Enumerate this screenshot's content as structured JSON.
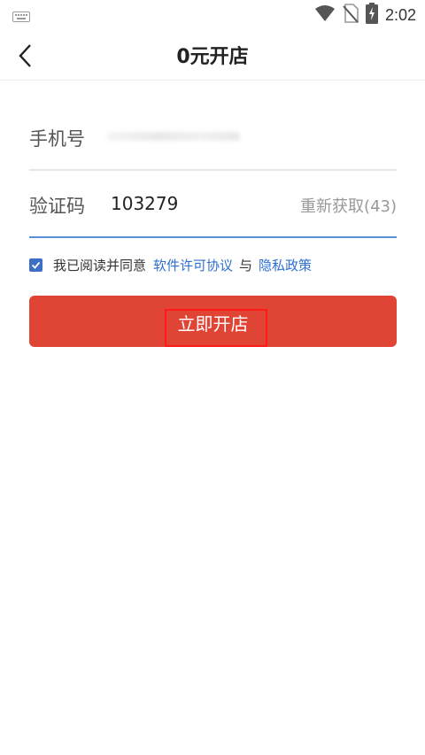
{
  "status_bar": {
    "time": "2:02",
    "icons": [
      "keyboard-icon",
      "wifi-icon",
      "no-sim-icon",
      "battery-charging-icon"
    ]
  },
  "header": {
    "title": "0元开店",
    "back_icon": "chevron-left-icon"
  },
  "form": {
    "phone_label": "手机号",
    "code_label": "验证码",
    "code_value": "103279",
    "resend_label": "重新获取(43)"
  },
  "agreement": {
    "checked": true,
    "prefix": "我已阅读并同意",
    "license_link": "软件许可协议",
    "conjunction": "与",
    "privacy_link": "隐私政策"
  },
  "submit": {
    "label": "立即开店"
  },
  "colors": {
    "accent_button": "#e04434",
    "link": "#2f6fd0",
    "checkbox": "#3b6fc6",
    "highlight_box": "#ff1a1a"
  }
}
